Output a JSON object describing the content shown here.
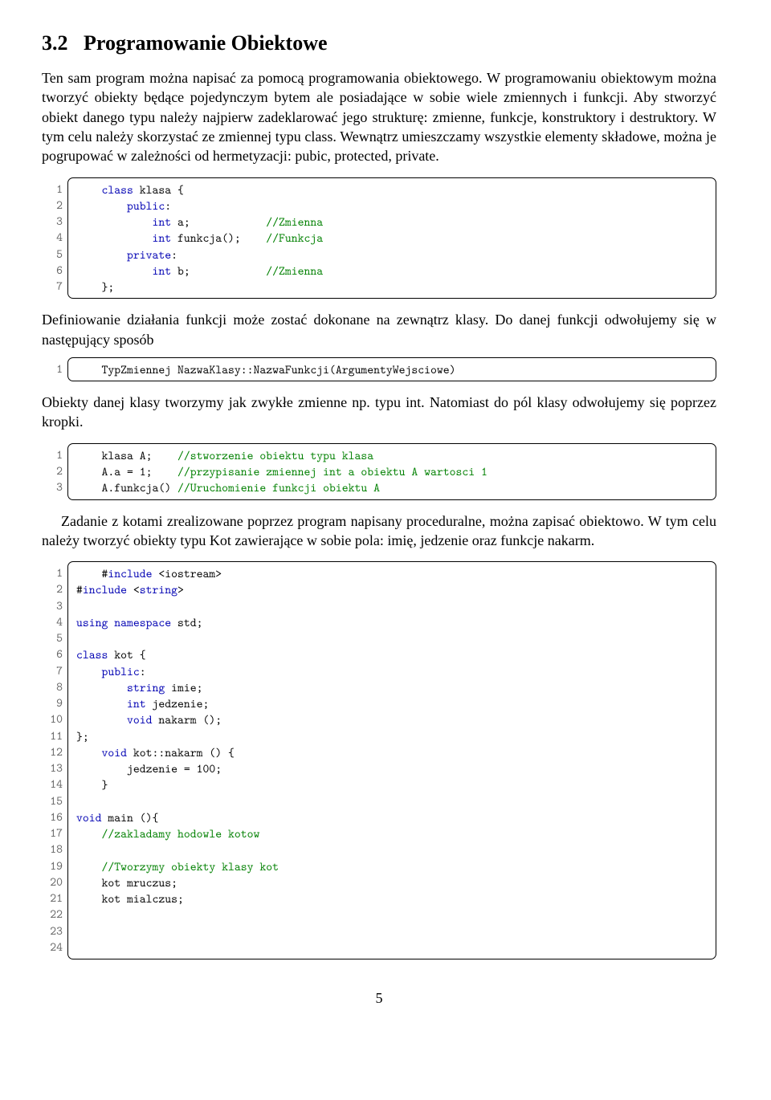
{
  "section": {
    "number": "3.2",
    "title": "Programowanie Obiektowe"
  },
  "para1": "Ten sam program można napisać za pomocą programowania obiektowego. W programowaniu obiektowym można tworzyć obiekty będące pojedynczym bytem ale posiadające w sobie wiele zmiennych i funkcji. Aby stworzyć obiekt danego typu należy najpierw zadeklarować jego strukturę: zmienne, funkcje, konstruktory i destruktory. W tym celu należy skorzystać ze zmiennej typu class. Wewnątrz umieszczamy wszystkie elementy składowe, można je pogrupować w zależności od hermetyzacji: pubic, protected, private.",
  "listing1": {
    "lines": [
      {
        "n": "1",
        "segs": [
          {
            "t": "    "
          },
          {
            "t": "class",
            "c": "kw"
          },
          {
            "t": " klasa {"
          }
        ]
      },
      {
        "n": "2",
        "segs": [
          {
            "t": "        "
          },
          {
            "t": "public",
            "c": "kw"
          },
          {
            "t": ":"
          }
        ]
      },
      {
        "n": "3",
        "segs": [
          {
            "t": "            "
          },
          {
            "t": "int",
            "c": "kw"
          },
          {
            "t": " a;            "
          },
          {
            "t": "//Zmienna",
            "c": "cm"
          }
        ]
      },
      {
        "n": "4",
        "segs": [
          {
            "t": "            "
          },
          {
            "t": "int",
            "c": "kw"
          },
          {
            "t": " funkcja();    "
          },
          {
            "t": "//Funkcja",
            "c": "cm"
          }
        ]
      },
      {
        "n": "5",
        "segs": [
          {
            "t": "        "
          },
          {
            "t": "private",
            "c": "kw"
          },
          {
            "t": ":"
          }
        ]
      },
      {
        "n": "6",
        "segs": [
          {
            "t": "            "
          },
          {
            "t": "int",
            "c": "kw"
          },
          {
            "t": " b;            "
          },
          {
            "t": "//Zmienna",
            "c": "cm"
          }
        ]
      },
      {
        "n": "7",
        "segs": [
          {
            "t": "    };"
          }
        ]
      }
    ]
  },
  "para2": "Definiowanie działania funkcji może zostać dokonane na zewnątrz klasy. Do danej funkcji odwołujemy się w następujący sposób",
  "listing2": {
    "lines": [
      {
        "n": "1",
        "segs": [
          {
            "t": "    TypZmiennej NazwaKlasy::NazwaFunkcji(ArgumentyWejsciowe)"
          }
        ]
      }
    ]
  },
  "para3": "Obiekty danej klasy tworzymy jak zwykłe zmienne np. typu int. Natomiast do pól klasy odwołujemy się poprzez kropki.",
  "listing3": {
    "lines": [
      {
        "n": "1",
        "segs": [
          {
            "t": "    klasa A;    "
          },
          {
            "t": "//stworzenie obiektu typu klasa",
            "c": "cm"
          }
        ]
      },
      {
        "n": "2",
        "segs": [
          {
            "t": "    A.a = 1;    "
          },
          {
            "t": "//przypisanie zmiennej int a obiektu A wartosci 1",
            "c": "cm"
          }
        ]
      },
      {
        "n": "3",
        "segs": [
          {
            "t": "    A.funkcja() "
          },
          {
            "t": "//Uruchomienie funkcji obiektu A",
            "c": "cm"
          }
        ]
      }
    ]
  },
  "para4": "Zadanie z kotami zrealizowane poprzez program napisany proceduralne, można zapisać obiektowo. W tym celu należy tworzyć obiekty typu Kot zawierające w sobie pola: imię, jedzenie oraz funkcje nakarm.",
  "listing4": {
    "lines": [
      {
        "n": "1",
        "segs": [
          {
            "t": "    #"
          },
          {
            "t": "include",
            "c": "kw"
          },
          {
            "t": " <iostream>"
          }
        ]
      },
      {
        "n": "2",
        "segs": [
          {
            "t": "#"
          },
          {
            "t": "include",
            "c": "kw"
          },
          {
            "t": " <"
          },
          {
            "t": "string",
            "c": "kw"
          },
          {
            "t": ">"
          }
        ]
      },
      {
        "n": "3",
        "segs": [
          {
            "t": " "
          }
        ]
      },
      {
        "n": "4",
        "segs": [
          {
            "t": "using",
            "c": "kw"
          },
          {
            "t": " "
          },
          {
            "t": "namespace",
            "c": "kw"
          },
          {
            "t": " std;"
          }
        ]
      },
      {
        "n": "5",
        "segs": [
          {
            "t": " "
          }
        ]
      },
      {
        "n": "6",
        "segs": [
          {
            "t": "class",
            "c": "kw"
          },
          {
            "t": " kot {"
          }
        ]
      },
      {
        "n": "7",
        "segs": [
          {
            "t": "    "
          },
          {
            "t": "public",
            "c": "kw"
          },
          {
            "t": ":"
          }
        ]
      },
      {
        "n": "8",
        "segs": [
          {
            "t": "        "
          },
          {
            "t": "string",
            "c": "kw"
          },
          {
            "t": " imie;"
          }
        ]
      },
      {
        "n": "9",
        "segs": [
          {
            "t": "        "
          },
          {
            "t": "int",
            "c": "kw"
          },
          {
            "t": " jedzenie;"
          }
        ]
      },
      {
        "n": "10",
        "segs": [
          {
            "t": "        "
          },
          {
            "t": "void",
            "c": "kw"
          },
          {
            "t": " nakarm ();"
          }
        ]
      },
      {
        "n": "11",
        "segs": [
          {
            "t": "};"
          }
        ]
      },
      {
        "n": "12",
        "segs": [
          {
            "t": "    "
          },
          {
            "t": "void",
            "c": "kw"
          },
          {
            "t": " kot::nakarm () {"
          }
        ]
      },
      {
        "n": "13",
        "segs": [
          {
            "t": "        jedzenie = 100;"
          }
        ]
      },
      {
        "n": "14",
        "segs": [
          {
            "t": "    }"
          }
        ]
      },
      {
        "n": "15",
        "segs": [
          {
            "t": " "
          }
        ]
      },
      {
        "n": "16",
        "segs": [
          {
            "t": "void",
            "c": "kw"
          },
          {
            "t": " main (){"
          }
        ]
      },
      {
        "n": "17",
        "segs": [
          {
            "t": "    "
          },
          {
            "t": "//zakladamy hodowle kotow",
            "c": "cm"
          }
        ]
      },
      {
        "n": "18",
        "segs": [
          {
            "t": " "
          }
        ]
      },
      {
        "n": "19",
        "segs": [
          {
            "t": "    "
          },
          {
            "t": "//Tworzymy obiekty klasy kot",
            "c": "cm"
          }
        ]
      },
      {
        "n": "20",
        "segs": [
          {
            "t": "    kot mruczus;"
          }
        ]
      },
      {
        "n": "21",
        "segs": [
          {
            "t": "    kot mialczus;"
          }
        ]
      },
      {
        "n": "22",
        "segs": [
          {
            "t": " "
          }
        ]
      },
      {
        "n": "23",
        "segs": [
          {
            "t": " "
          }
        ]
      },
      {
        "n": "24",
        "segs": [
          {
            "t": " "
          }
        ]
      }
    ]
  },
  "pagenum": "5"
}
